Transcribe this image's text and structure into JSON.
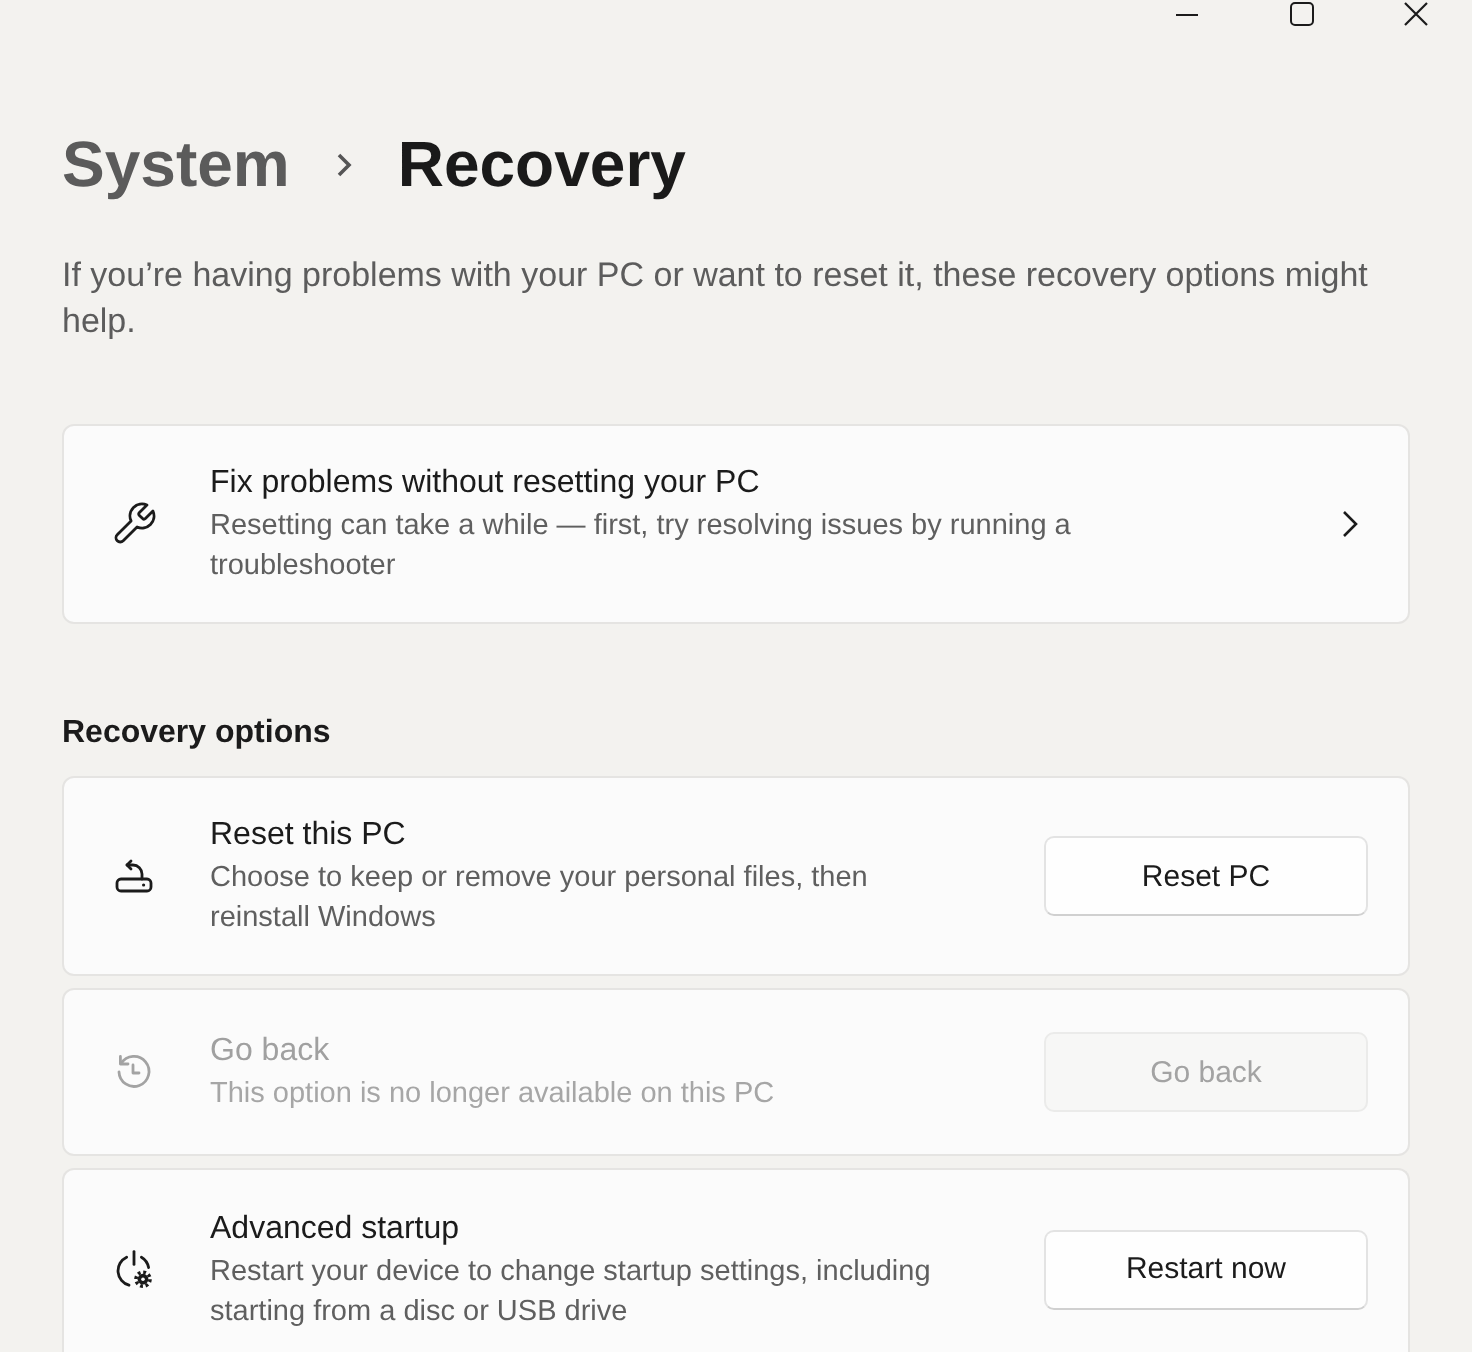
{
  "breadcrumb": [
    {
      "label": "System",
      "current": false
    },
    {
      "label": "Recovery",
      "current": true
    }
  ],
  "description": "If you’re having problems with your PC or want to reset it, these recovery options might help.",
  "troubleshoot_card": {
    "title": "Fix problems without resetting your PC",
    "subtitle": "Resetting can take a while — first, try resolving issues by running a troubleshooter"
  },
  "section_heading": "Recovery options",
  "options": [
    {
      "title": "Reset this PC",
      "subtitle": "Choose to keep or remove your personal files, then reinstall Windows",
      "button": "Reset PC",
      "disabled": false
    },
    {
      "title": "Go back",
      "subtitle": "This option is no longer available on this PC",
      "button": "Go back",
      "disabled": true
    },
    {
      "title": "Advanced startup",
      "subtitle": "Restart your device to change startup settings, including starting from a disc or USB drive",
      "button": "Restart now",
      "disabled": false
    }
  ]
}
